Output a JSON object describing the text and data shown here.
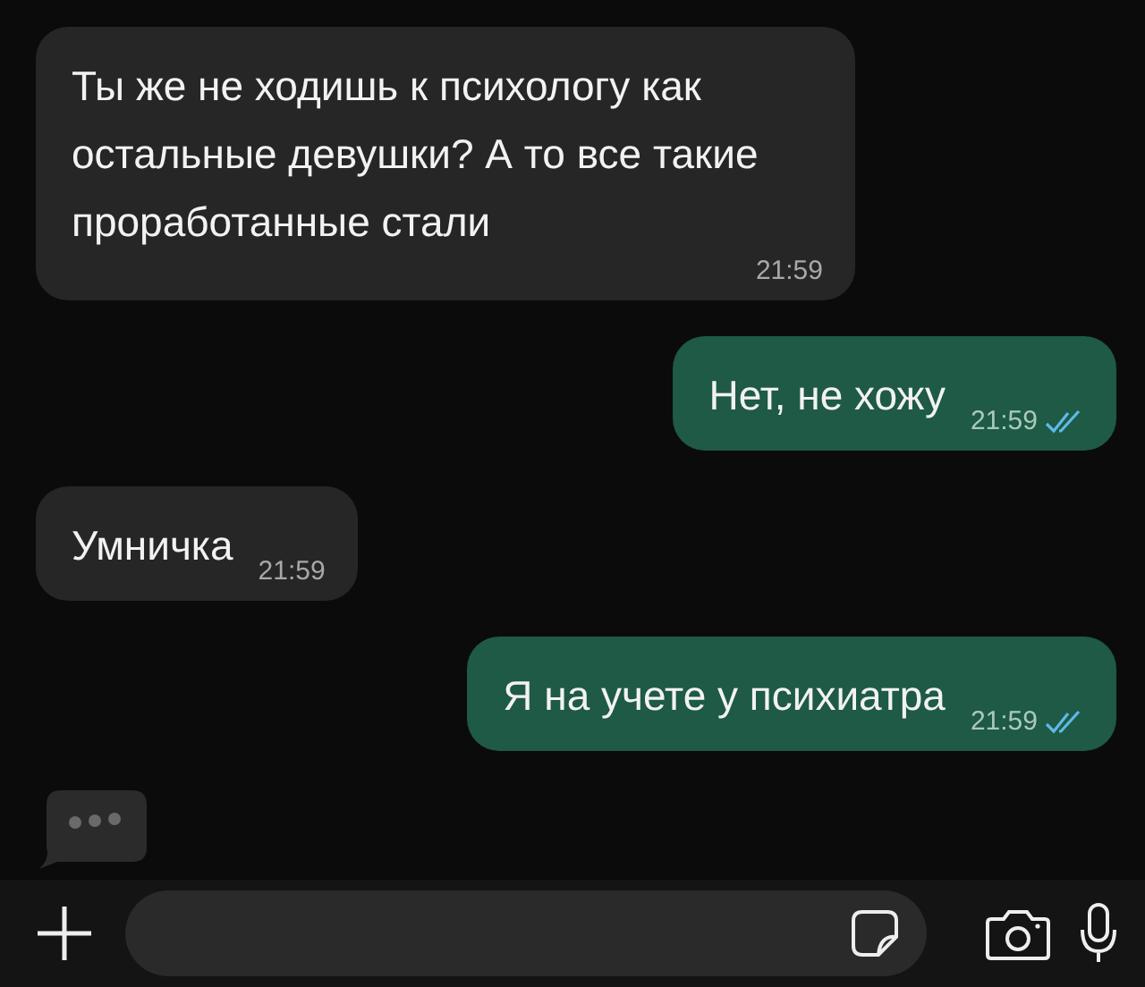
{
  "messages": [
    {
      "kind": "incoming",
      "text": "Ты же не ходишь к психологу как остальные девушки? А то все такие проработанные стали",
      "time": "21:59"
    },
    {
      "kind": "outgoing",
      "text": "Нет, не хожу",
      "time": "21:59",
      "read": true
    },
    {
      "kind": "incoming",
      "text": "Умничка",
      "time": "21:59"
    },
    {
      "kind": "outgoing",
      "text": "Я на учете у психиатра",
      "time": "21:59",
      "read": true
    }
  ],
  "typing": true
}
